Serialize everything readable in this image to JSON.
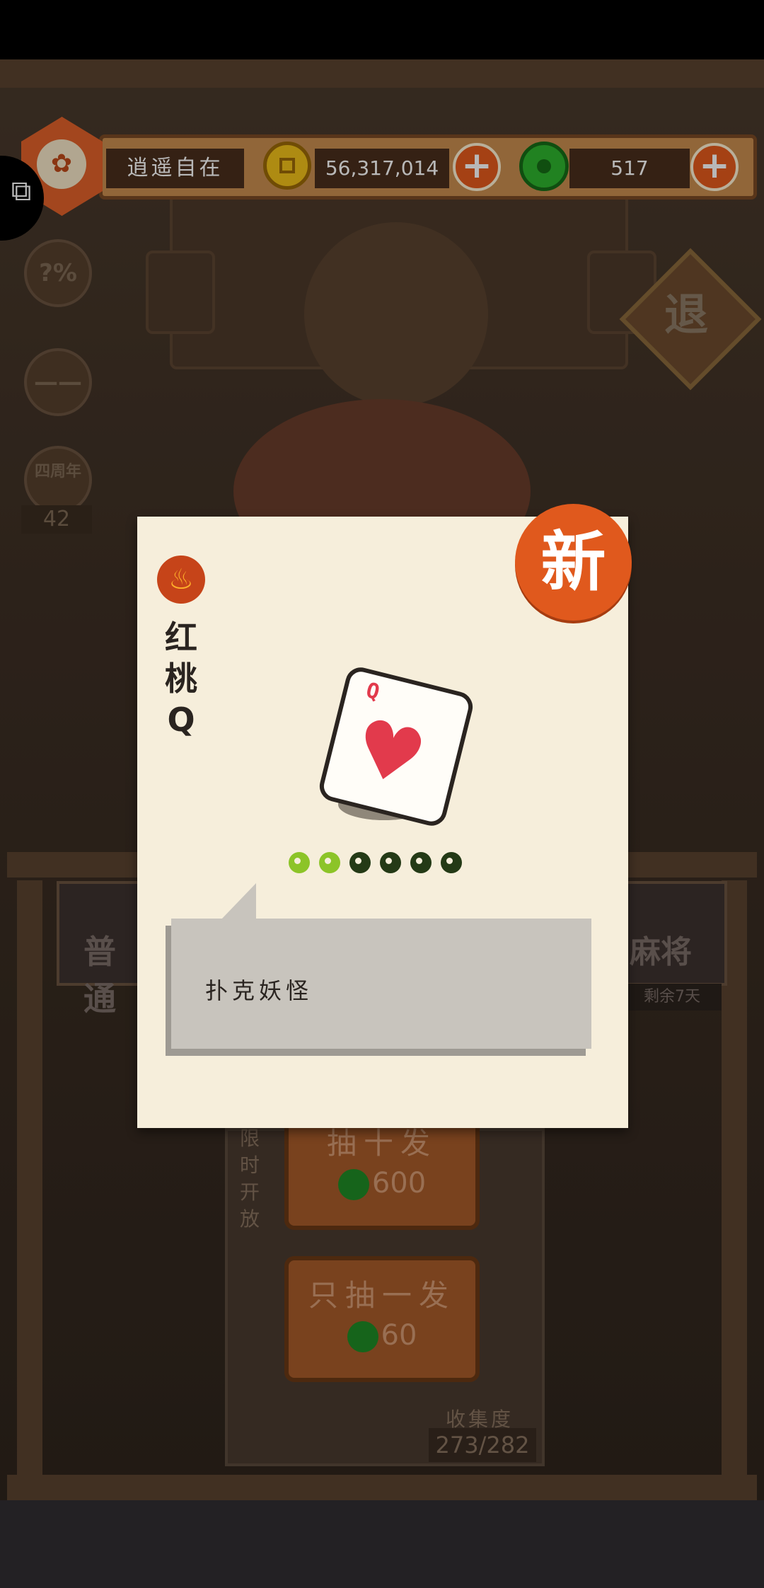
{
  "player": {
    "name": "逍遥自在"
  },
  "currency": {
    "coins": "56,317,014",
    "jade": "517",
    "add_symbol": "+"
  },
  "sidebar": {
    "odds_label": "?%",
    "emote_label": "——",
    "anniversary_label": "四周年",
    "anniversary_count": "42"
  },
  "retreat_label": "退",
  "card_modal": {
    "name": "红桃Q",
    "name_lines": [
      "红",
      "桃",
      "Q"
    ],
    "new_badge": "新",
    "card_rank": "Q",
    "card_suit_symbol": "♥",
    "level_filled": 2,
    "level_total": 6,
    "category": "扑克妖怪"
  },
  "background": {
    "left_tab_label": "普通",
    "right_tab_label": "麻将",
    "right_tab_sub": "剩余7天",
    "limited_label": "限时开放",
    "draw_ten_label": "抽十发",
    "draw_ten_cost": "600",
    "draw_one_label": "只抽一发",
    "draw_one_cost": "60",
    "collection_title": "收集度",
    "collection_value": "273/282"
  },
  "colors": {
    "accent": "#e0591d",
    "heart": "#e23a4c",
    "jade_lit": "#8cc428",
    "jade_dark": "#243a16",
    "modal_bg": "#f6eedb"
  }
}
